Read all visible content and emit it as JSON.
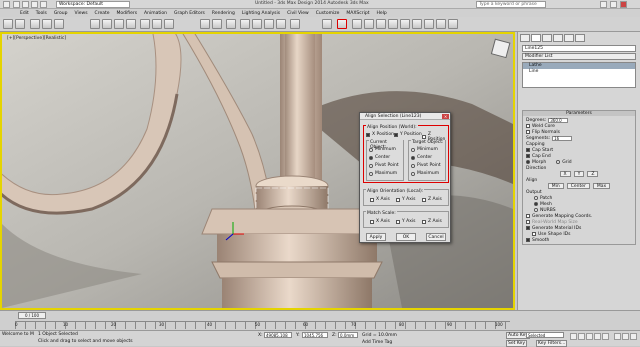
{
  "titlebar": {
    "workspace": "Workspace: Default",
    "title": "Untitled - 3ds Max Design 2014   Autodesk 3ds Max",
    "search_placeholder": "Type a keyword or phrase"
  },
  "menu": [
    "Edit",
    "Tools",
    "Group",
    "Views",
    "Create",
    "Modifiers",
    "Animation",
    "Graph Editors",
    "Rendering",
    "Lighting Analysis",
    "Civil View",
    "Customize",
    "MAXScript",
    "Help"
  ],
  "viewport": {
    "label": "[+][Perspective][Realistic]"
  },
  "command_panel": {
    "object_name": "Line125",
    "modifier_list": "Modifier List",
    "stack": [
      "Lathe",
      "Line"
    ],
    "parameters_title": "Parameters",
    "degrees_label": "Degrees:",
    "degrees_value": "360.0",
    "weld_core": "Weld Core",
    "flip_normals": "Flip Normals",
    "segments_label": "Segments:",
    "segments_value": "16",
    "capping_label": "Capping",
    "cap_start": "Cap Start",
    "cap_end": "Cap End",
    "morph": "Morph",
    "grid": "Grid",
    "direction_label": "Direction",
    "dir_x": "X",
    "dir_y": "Y",
    "dir_z": "Z",
    "align_label": "Align",
    "align_min": "Min",
    "align_center": "Center",
    "align_max": "Max",
    "output_label": "Output",
    "patch": "Patch",
    "mesh": "Mesh",
    "nurbs": "NURBS",
    "gen_mapping": "Generate Mapping Coords.",
    "real_world": "Real-World Map Size",
    "gen_mat_ids": "Generate Material IDs",
    "use_shape_ids": "Use Shape IDs",
    "smooth": "Smooth"
  },
  "dialog": {
    "title": "Align Selection (Line123)",
    "align_position_label": "Align Position (World):",
    "x_position": "X Position",
    "y_position": "Y Position",
    "z_position": "Z Position",
    "current_object": "Current Object:",
    "target_object": "Target Object:",
    "minimum": "Minimum",
    "center": "Center",
    "pivot_point": "Pivot Point",
    "maximum": "Maximum",
    "align_orientation_label": "Align Orientation (Local):",
    "x_axis": "X Axis",
    "y_axis": "Y Axis",
    "z_axis": "Z Axis",
    "match_scale_label": "Match Scale:",
    "apply": "Apply",
    "ok": "OK",
    "cancel": "Cancel"
  },
  "timeline": {
    "frame": "0 / 100",
    "ticks": [
      "0",
      "10",
      "20",
      "30",
      "40",
      "50",
      "60",
      "70",
      "80",
      "90",
      "100"
    ]
  },
  "statusbar": {
    "welcome": "Welcome to M",
    "selected": "1 Object Selected",
    "hint": "Click and drag to select and move objects",
    "x_label": "X:",
    "x_value": "49085.108",
    "y_label": "Y:",
    "y_value": "1045.756",
    "z_label": "Z:",
    "z_value": "0.0mm",
    "grid": "Grid = 10.0mm",
    "add_time_tag": "Add Time Tag",
    "auto_key": "Auto Key",
    "selected_dropdown": "Selected",
    "set_key": "Set Key",
    "key_filters": "Key Filters..."
  }
}
